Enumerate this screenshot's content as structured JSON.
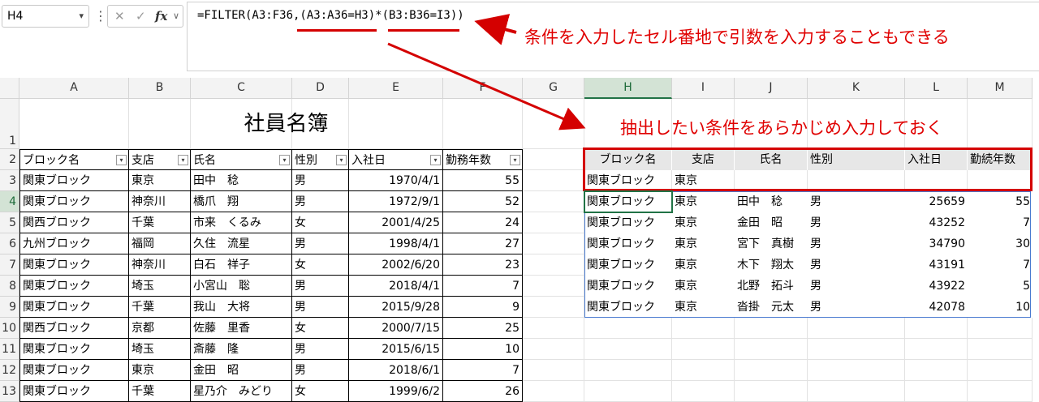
{
  "formula_bar": {
    "name_box": "H4",
    "cancel_glyph": "✕",
    "enter_glyph": "✓",
    "fx_label": "fx",
    "formula": "=FILTER(A3:F36,(A3:A36=H3)*(B3:B36=I3))"
  },
  "annotations": {
    "top": "条件を入力したセル番地で引数を入力することもできる",
    "middle": "抽出したい条件をあらかじめ入力しておく"
  },
  "columns": [
    "A",
    "B",
    "C",
    "D",
    "E",
    "F",
    "G",
    "H",
    "I",
    "J",
    "K",
    "L",
    "M"
  ],
  "rows": [
    "1",
    "2",
    "3",
    "4",
    "5",
    "6",
    "7",
    "8",
    "9",
    "10",
    "11",
    "12",
    "13"
  ],
  "title": "社員名簿",
  "source_headers": [
    "ブロック名",
    "支店",
    "氏名",
    "性別",
    "入社日",
    "勤務年数"
  ],
  "source_rows": [
    [
      "関東ブロック",
      "東京",
      "田中　稔",
      "男",
      "1970/4/1",
      "55"
    ],
    [
      "関東ブロック",
      "神奈川",
      "橋爪　翔",
      "男",
      "1972/9/1",
      "52"
    ],
    [
      "関西ブロック",
      "千葉",
      "市来　くるみ",
      "女",
      "2001/4/25",
      "24"
    ],
    [
      "九州ブロック",
      "福岡",
      "久住　流星",
      "男",
      "1998/4/1",
      "27"
    ],
    [
      "関東ブロック",
      "神奈川",
      "白石　祥子",
      "女",
      "2002/6/20",
      "23"
    ],
    [
      "関東ブロック",
      "埼玉",
      "小宮山　聡",
      "男",
      "2018/4/1",
      "7"
    ],
    [
      "関東ブロック",
      "千葉",
      "我山　大将",
      "男",
      "2015/9/28",
      "9"
    ],
    [
      "関西ブロック",
      "京都",
      "佐藤　里香",
      "女",
      "2000/7/15",
      "25"
    ],
    [
      "関東ブロック",
      "埼玉",
      "斎藤　隆",
      "男",
      "2015/6/15",
      "10"
    ],
    [
      "関東ブロック",
      "東京",
      "金田　昭",
      "男",
      "2018/6/1",
      "7"
    ],
    [
      "関東ブロック",
      "千葉",
      "星乃介　みどり",
      "女",
      "1999/6/2",
      "26"
    ]
  ],
  "criteria_headers": [
    "ブロック名",
    "支店",
    "氏名",
    "性別",
    "入社日",
    "勤続年数"
  ],
  "criteria_values": [
    "関東ブロック",
    "東京"
  ],
  "result_rows": [
    [
      "関東ブロック",
      "東京",
      "田中　稔",
      "男",
      "25659",
      "55"
    ],
    [
      "関東ブロック",
      "東京",
      "金田　昭",
      "男",
      "43252",
      "7"
    ],
    [
      "関東ブロック",
      "東京",
      "宮下　真樹",
      "男",
      "34790",
      "30"
    ],
    [
      "関東ブロック",
      "東京",
      "木下　翔太",
      "男",
      "43191",
      "7"
    ],
    [
      "関東ブロック",
      "東京",
      "北野　拓斗",
      "男",
      "43922",
      "5"
    ],
    [
      "関東ブロック",
      "東京",
      "沓掛　元太",
      "男",
      "42078",
      "10"
    ]
  ],
  "colors": {
    "annotation": "#e00000",
    "selection": "#217346"
  }
}
